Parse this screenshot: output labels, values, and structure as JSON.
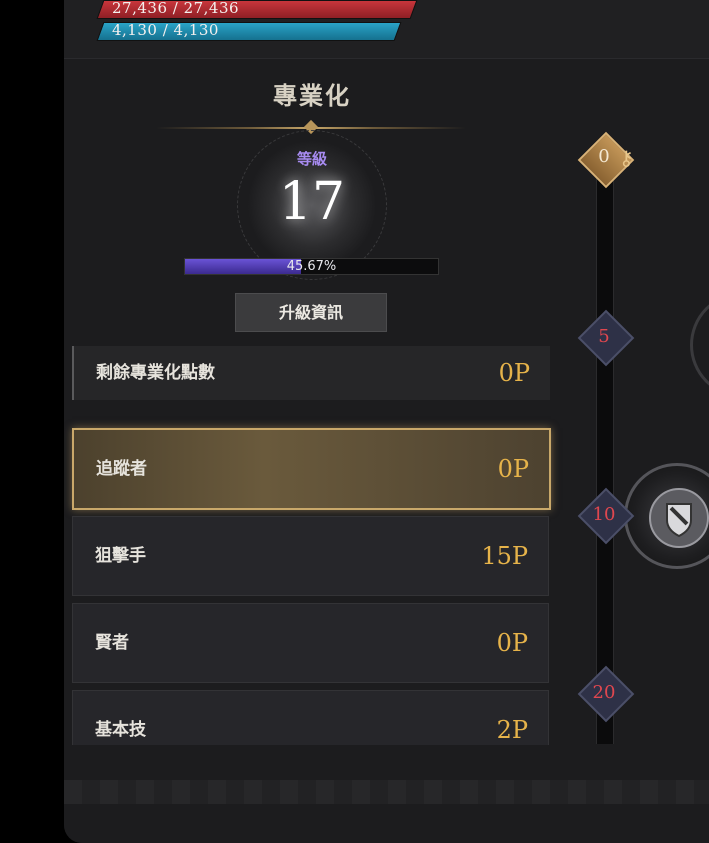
{
  "status_bars": {
    "hp_text": "27,436 / 27,436",
    "mp_text": "4,130 / 4,130"
  },
  "title": "專業化",
  "level": {
    "label": "等級",
    "value": "17",
    "exp_percent": 45.67,
    "exp_text": "45.67%"
  },
  "upgrade_button_label": "升級資訊",
  "remaining_points": {
    "label": "剩餘專業化點數",
    "value": "0P"
  },
  "specializations": [
    {
      "name": "追蹤者",
      "points": "0P",
      "selected": true
    },
    {
      "name": "狙擊手",
      "points": "15P",
      "selected": false
    },
    {
      "name": "賢者",
      "points": "0P",
      "selected": false
    },
    {
      "name": "基本技",
      "points": "2P",
      "selected": false
    }
  ],
  "progress_track": {
    "nodes": [
      "0",
      "5",
      "10",
      "20"
    ]
  },
  "colors": {
    "hp": "#c8363c",
    "mp": "#2aa3c7",
    "exp": "#6a53d6",
    "points": "#e6b34a",
    "level_label": "#a78bf0",
    "node_label": "#e0474f",
    "selected_border": "#c9a86a"
  },
  "icons": {
    "key": "key-icon",
    "skill": "shield-sword-icon"
  }
}
